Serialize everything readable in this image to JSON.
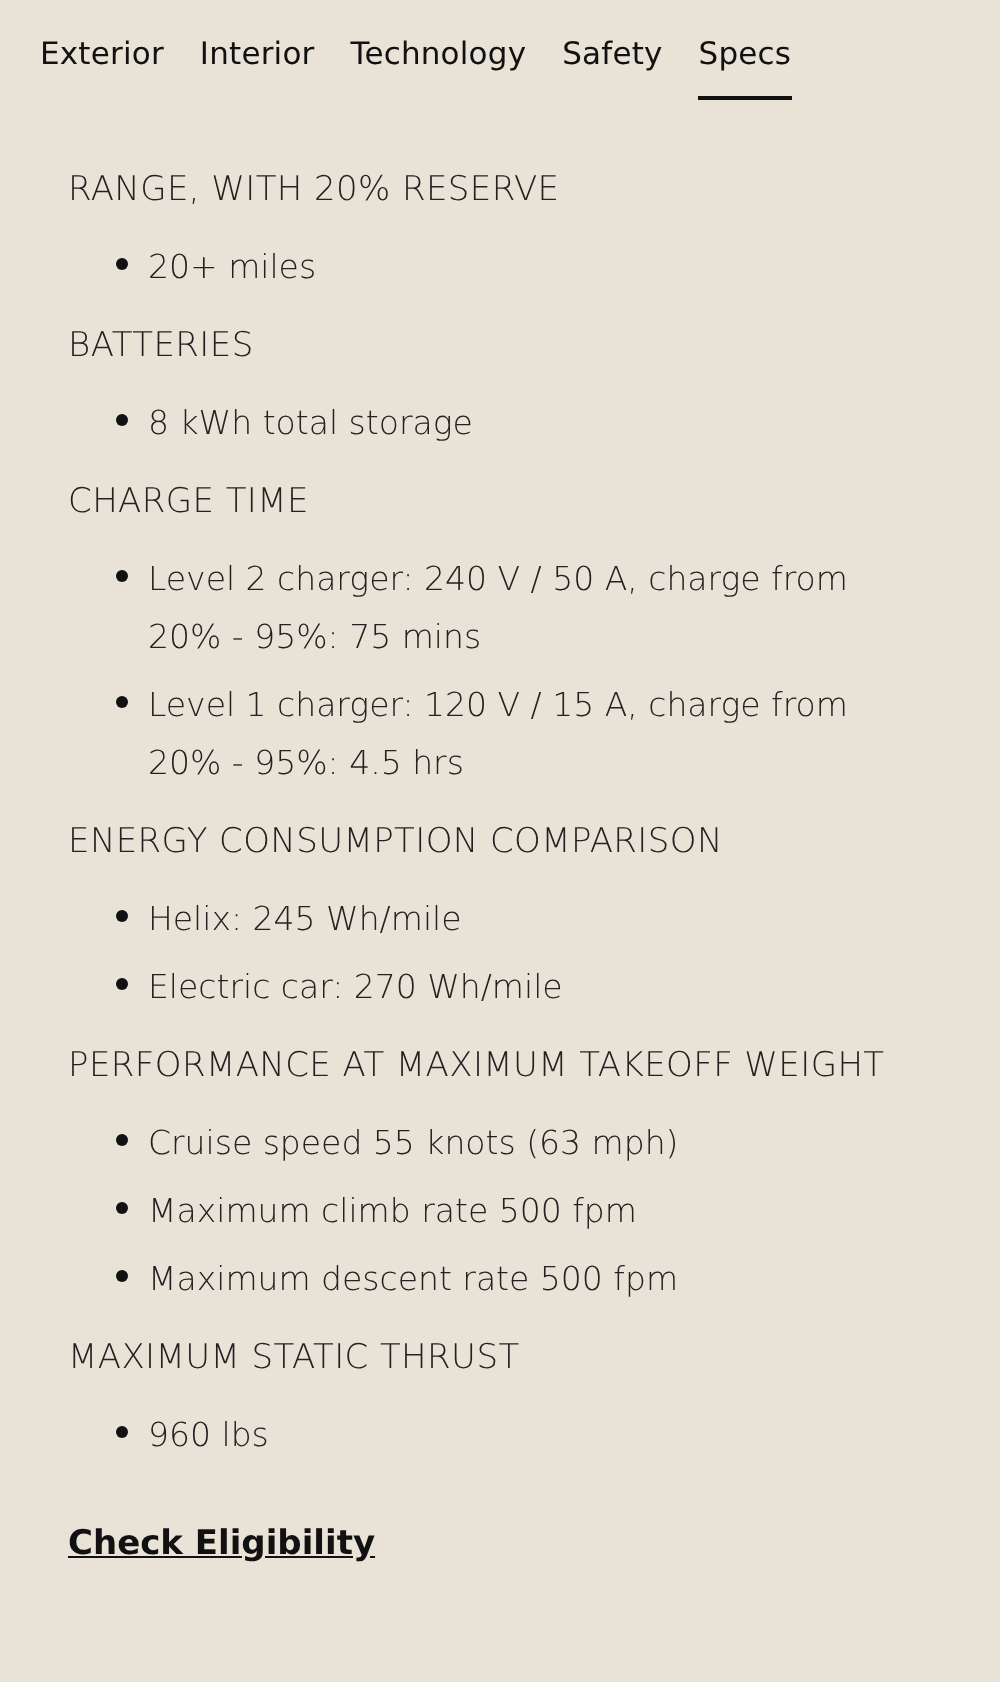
{
  "tabs": [
    {
      "label": "Exterior",
      "selected": false
    },
    {
      "label": "Interior",
      "selected": false
    },
    {
      "label": "Technology",
      "selected": false
    },
    {
      "label": "Safety",
      "selected": false
    },
    {
      "label": "Specs",
      "selected": true
    }
  ],
  "sections": [
    {
      "heading": "RANGE, WITH 20% RESERVE",
      "items": [
        "20+ miles"
      ]
    },
    {
      "heading": "BATTERIES",
      "items": [
        "8 kWh total storage"
      ]
    },
    {
      "heading": "CHARGE TIME",
      "items": [
        "Level 2 charger: 240 V / 50 A, charge from 20% - 95%: 75 mins",
        "Level 1 charger: 120 V / 15 A, charge from 20% - 95%: 4.5 hrs"
      ]
    },
    {
      "heading": "ENERGY CONSUMPTION COMPARISON",
      "items": [
        "Helix: 245 Wh/mile",
        "Electric car: 270 Wh/mile"
      ]
    },
    {
      "heading": "PERFORMANCE AT MAXIMUM TAKEOFF WEIGHT",
      "items": [
        "Cruise speed 55 knots (63 mph)",
        "Maximum climb rate 500 fpm",
        "Maximum descent rate 500 fpm"
      ]
    },
    {
      "heading": "MAXIMUM STATIC THRUST",
      "items": [
        "960 lbs"
      ]
    }
  ],
  "link": "Check Eligibility"
}
